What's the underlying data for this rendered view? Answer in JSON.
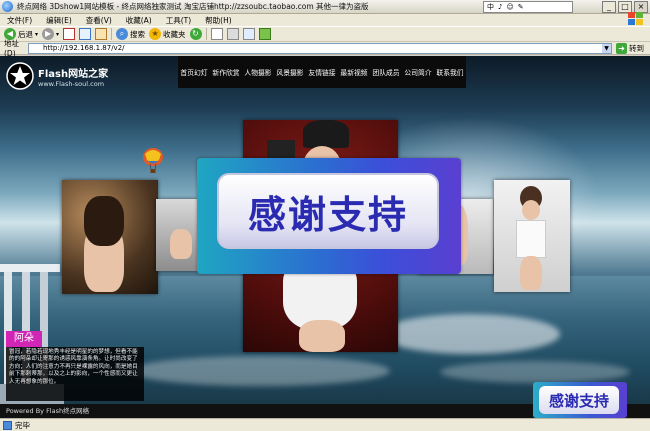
{
  "window": {
    "title": "终点网络 3Dshow1网站模板 - 终点网络独家测试 淘宝店铺http://zzsoubc.taobao.com 其他一律为盗版",
    "ime_text": "中",
    "ime_icons": [
      "♪",
      "☺",
      "✎"
    ],
    "minimize": "_",
    "maximize": "□",
    "close": "×"
  },
  "menu": {
    "items": [
      "文件(F)",
      "编辑(E)",
      "查看(V)",
      "收藏(A)",
      "工具(T)",
      "帮助(H)"
    ]
  },
  "toolbar": {
    "back_label": "后退",
    "search_label": "搜索",
    "favorites_label": "收藏夹"
  },
  "address": {
    "label": "地址(D)",
    "url": "http://192.168.1.87/v2/",
    "go_label": "转到"
  },
  "site": {
    "logo_name": "Flash网站之家",
    "logo_url": "www.Flash-soul.com",
    "nav": [
      "首页幻灯",
      "新作欣赏",
      "人物摄影",
      "风景摄影",
      "友情链接",
      "最新视频",
      "团队成员",
      "公司简介",
      "联系我们"
    ],
    "banner_text": "感谢支持",
    "badge_text": "感谢支持",
    "profile_name": "阿朵",
    "profile_desc": "冒冠，若隐若现地秀丰经是明星的的梦想，但看不能的的阿朵却让寄那的诱惑风靠演条角。让时尚改变了方向；人们的注意力不再只是裸露的风向，而是她目前下那刺蒂那，以及之上的影向，一个性感而又更让人无再想象的那位。",
    "footer_text": "Powered By Flash终点网络"
  },
  "status": {
    "text": "完毕"
  },
  "colors": {
    "nav_bg": "#0b0b0b",
    "name_tag": "#d126b5",
    "banner_text": "#2a2bb0"
  }
}
